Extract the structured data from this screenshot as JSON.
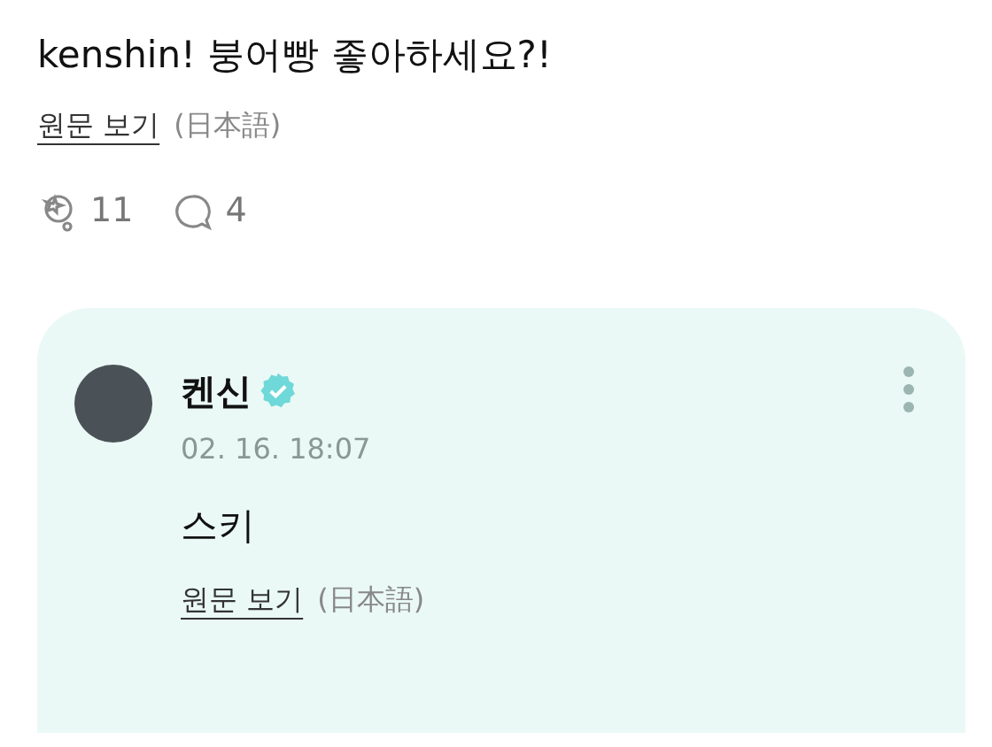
{
  "post": {
    "text": "kenshin! 붕어빵 좋아하세요?!",
    "translate": {
      "link": "원문 보기",
      "language": "(日本語)"
    },
    "reactions": [
      {
        "kind": "like",
        "count": "11"
      },
      {
        "kind": "comment",
        "count": "4"
      }
    ]
  },
  "reply": {
    "author": "켄신",
    "verified": true,
    "time": "02. 16. 18:07",
    "text": "스키",
    "translate": {
      "link": "원문 보기",
      "language": "(日本語)"
    }
  }
}
